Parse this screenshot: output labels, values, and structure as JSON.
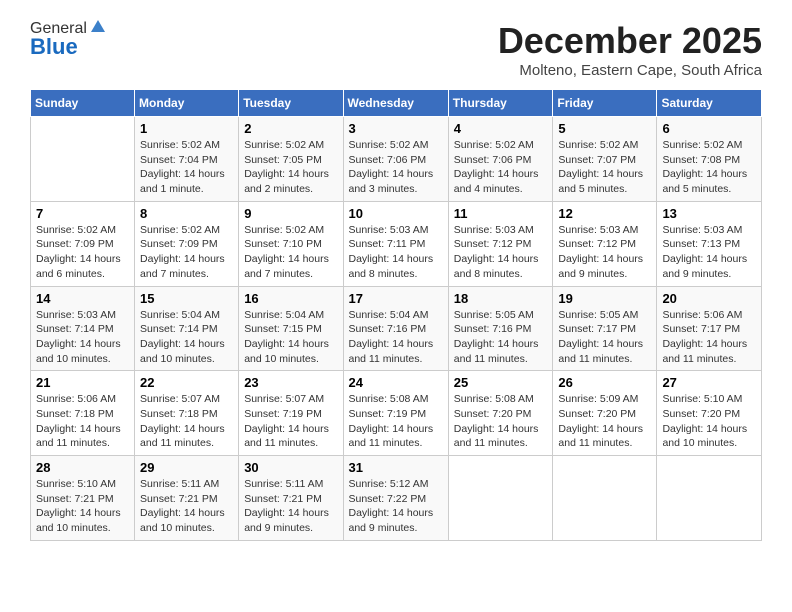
{
  "logo": {
    "general": "General",
    "blue": "Blue"
  },
  "title": {
    "month": "December 2025",
    "location": "Molteno, Eastern Cape, South Africa"
  },
  "days_of_week": [
    "Sunday",
    "Monday",
    "Tuesday",
    "Wednesday",
    "Thursday",
    "Friday",
    "Saturday"
  ],
  "weeks": [
    [
      {
        "day": "",
        "sunrise": "",
        "sunset": "",
        "daylight": ""
      },
      {
        "day": "1",
        "sunrise": "Sunrise: 5:02 AM",
        "sunset": "Sunset: 7:04 PM",
        "daylight": "Daylight: 14 hours and 1 minute."
      },
      {
        "day": "2",
        "sunrise": "Sunrise: 5:02 AM",
        "sunset": "Sunset: 7:05 PM",
        "daylight": "Daylight: 14 hours and 2 minutes."
      },
      {
        "day": "3",
        "sunrise": "Sunrise: 5:02 AM",
        "sunset": "Sunset: 7:06 PM",
        "daylight": "Daylight: 14 hours and 3 minutes."
      },
      {
        "day": "4",
        "sunrise": "Sunrise: 5:02 AM",
        "sunset": "Sunset: 7:06 PM",
        "daylight": "Daylight: 14 hours and 4 minutes."
      },
      {
        "day": "5",
        "sunrise": "Sunrise: 5:02 AM",
        "sunset": "Sunset: 7:07 PM",
        "daylight": "Daylight: 14 hours and 5 minutes."
      },
      {
        "day": "6",
        "sunrise": "Sunrise: 5:02 AM",
        "sunset": "Sunset: 7:08 PM",
        "daylight": "Daylight: 14 hours and 5 minutes."
      }
    ],
    [
      {
        "day": "7",
        "sunrise": "Sunrise: 5:02 AM",
        "sunset": "Sunset: 7:09 PM",
        "daylight": "Daylight: 14 hours and 6 minutes."
      },
      {
        "day": "8",
        "sunrise": "Sunrise: 5:02 AM",
        "sunset": "Sunset: 7:09 PM",
        "daylight": "Daylight: 14 hours and 7 minutes."
      },
      {
        "day": "9",
        "sunrise": "Sunrise: 5:02 AM",
        "sunset": "Sunset: 7:10 PM",
        "daylight": "Daylight: 14 hours and 7 minutes."
      },
      {
        "day": "10",
        "sunrise": "Sunrise: 5:03 AM",
        "sunset": "Sunset: 7:11 PM",
        "daylight": "Daylight: 14 hours and 8 minutes."
      },
      {
        "day": "11",
        "sunrise": "Sunrise: 5:03 AM",
        "sunset": "Sunset: 7:12 PM",
        "daylight": "Daylight: 14 hours and 8 minutes."
      },
      {
        "day": "12",
        "sunrise": "Sunrise: 5:03 AM",
        "sunset": "Sunset: 7:12 PM",
        "daylight": "Daylight: 14 hours and 9 minutes."
      },
      {
        "day": "13",
        "sunrise": "Sunrise: 5:03 AM",
        "sunset": "Sunset: 7:13 PM",
        "daylight": "Daylight: 14 hours and 9 minutes."
      }
    ],
    [
      {
        "day": "14",
        "sunrise": "Sunrise: 5:03 AM",
        "sunset": "Sunset: 7:14 PM",
        "daylight": "Daylight: 14 hours and 10 minutes."
      },
      {
        "day": "15",
        "sunrise": "Sunrise: 5:04 AM",
        "sunset": "Sunset: 7:14 PM",
        "daylight": "Daylight: 14 hours and 10 minutes."
      },
      {
        "day": "16",
        "sunrise": "Sunrise: 5:04 AM",
        "sunset": "Sunset: 7:15 PM",
        "daylight": "Daylight: 14 hours and 10 minutes."
      },
      {
        "day": "17",
        "sunrise": "Sunrise: 5:04 AM",
        "sunset": "Sunset: 7:16 PM",
        "daylight": "Daylight: 14 hours and 11 minutes."
      },
      {
        "day": "18",
        "sunrise": "Sunrise: 5:05 AM",
        "sunset": "Sunset: 7:16 PM",
        "daylight": "Daylight: 14 hours and 11 minutes."
      },
      {
        "day": "19",
        "sunrise": "Sunrise: 5:05 AM",
        "sunset": "Sunset: 7:17 PM",
        "daylight": "Daylight: 14 hours and 11 minutes."
      },
      {
        "day": "20",
        "sunrise": "Sunrise: 5:06 AM",
        "sunset": "Sunset: 7:17 PM",
        "daylight": "Daylight: 14 hours and 11 minutes."
      }
    ],
    [
      {
        "day": "21",
        "sunrise": "Sunrise: 5:06 AM",
        "sunset": "Sunset: 7:18 PM",
        "daylight": "Daylight: 14 hours and 11 minutes."
      },
      {
        "day": "22",
        "sunrise": "Sunrise: 5:07 AM",
        "sunset": "Sunset: 7:18 PM",
        "daylight": "Daylight: 14 hours and 11 minutes."
      },
      {
        "day": "23",
        "sunrise": "Sunrise: 5:07 AM",
        "sunset": "Sunset: 7:19 PM",
        "daylight": "Daylight: 14 hours and 11 minutes."
      },
      {
        "day": "24",
        "sunrise": "Sunrise: 5:08 AM",
        "sunset": "Sunset: 7:19 PM",
        "daylight": "Daylight: 14 hours and 11 minutes."
      },
      {
        "day": "25",
        "sunrise": "Sunrise: 5:08 AM",
        "sunset": "Sunset: 7:20 PM",
        "daylight": "Daylight: 14 hours and 11 minutes."
      },
      {
        "day": "26",
        "sunrise": "Sunrise: 5:09 AM",
        "sunset": "Sunset: 7:20 PM",
        "daylight": "Daylight: 14 hours and 11 minutes."
      },
      {
        "day": "27",
        "sunrise": "Sunrise: 5:10 AM",
        "sunset": "Sunset: 7:20 PM",
        "daylight": "Daylight: 14 hours and 10 minutes."
      }
    ],
    [
      {
        "day": "28",
        "sunrise": "Sunrise: 5:10 AM",
        "sunset": "Sunset: 7:21 PM",
        "daylight": "Daylight: 14 hours and 10 minutes."
      },
      {
        "day": "29",
        "sunrise": "Sunrise: 5:11 AM",
        "sunset": "Sunset: 7:21 PM",
        "daylight": "Daylight: 14 hours and 10 minutes."
      },
      {
        "day": "30",
        "sunrise": "Sunrise: 5:11 AM",
        "sunset": "Sunset: 7:21 PM",
        "daylight": "Daylight: 14 hours and 9 minutes."
      },
      {
        "day": "31",
        "sunrise": "Sunrise: 5:12 AM",
        "sunset": "Sunset: 7:22 PM",
        "daylight": "Daylight: 14 hours and 9 minutes."
      },
      {
        "day": "",
        "sunrise": "",
        "sunset": "",
        "daylight": ""
      },
      {
        "day": "",
        "sunrise": "",
        "sunset": "",
        "daylight": ""
      },
      {
        "day": "",
        "sunrise": "",
        "sunset": "",
        "daylight": ""
      }
    ]
  ]
}
